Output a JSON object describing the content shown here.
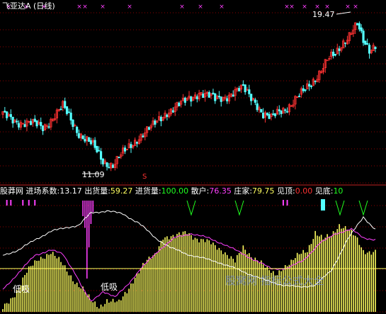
{
  "colors": {
    "background": "#000000",
    "grid": "#8b0000",
    "candle_up": "#ff3232",
    "candle_down": "#54ffff",
    "x_marker": "#ff40ff",
    "white_line": "#ffffff",
    "magenta_line": "#ff40ff",
    "yellow_line": "#ffff60",
    "yellow_bars": "#ffff60",
    "green_v": "#20ff20",
    "cyan_marker": "#54ffff"
  },
  "top_panel": {
    "title": "飞亚达A (日线)",
    "high_label": "19.47",
    "low_label": "11.09",
    "signal_label": "S"
  },
  "bottom_panel": {
    "indicator_name": "股莽网",
    "params": [
      {
        "label": "进场系数:",
        "value": "13.17",
        "color": "#ffffff"
      },
      {
        "label": "出货量:",
        "value": "59.27",
        "color": "#ffff60"
      },
      {
        "label": "进货量:",
        "value": "100.00",
        "color": "#20ff20"
      },
      {
        "label": "散户:",
        "value": "76.35",
        "color": "#ff40ff"
      },
      {
        "label": "庄家:",
        "value": "79.75",
        "color": "#ffff60"
      },
      {
        "label": "见顶:",
        "value": "0.00",
        "color": "#ff3232"
      },
      {
        "label": "见底:",
        "value": "10",
        "color": "#20ff20"
      }
    ],
    "annotations": [
      "低吸",
      "低吸"
    ],
    "watermark": "股窝网 指标公式大全"
  },
  "chart_data": [
    {
      "type": "candlestick",
      "title": "飞亚达A (日线)",
      "annotations": [
        {
          "text": "19.47",
          "type": "high"
        },
        {
          "text": "11.09",
          "type": "low"
        }
      ],
      "close_anchors": [
        [
          0,
          14.1
        ],
        [
          12,
          13.7
        ],
        [
          20,
          13.5
        ],
        [
          30,
          14.6
        ],
        [
          38,
          13.2
        ],
        [
          45,
          12.4
        ],
        [
          50,
          11.6
        ],
        [
          55,
          11.4
        ],
        [
          62,
          12.2
        ],
        [
          68,
          13.0
        ],
        [
          75,
          13.5
        ],
        [
          82,
          14.4
        ],
        [
          90,
          14.8
        ],
        [
          98,
          15.5
        ],
        [
          106,
          15.0
        ],
        [
          114,
          15.4
        ],
        [
          120,
          15.6
        ],
        [
          126,
          15.0
        ],
        [
          130,
          14.2
        ],
        [
          134,
          13.9
        ],
        [
          138,
          14.4
        ],
        [
          144,
          14.8
        ],
        [
          150,
          15.4
        ],
        [
          156,
          16.3
        ],
        [
          162,
          17.2
        ],
        [
          166,
          17.5
        ],
        [
          170,
          18.3
        ],
        [
          174,
          18.9
        ],
        [
          177,
          19.2
        ],
        [
          180,
          18.2
        ],
        [
          183,
          17.8
        ],
        [
          186,
          18.2
        ]
      ],
      "bars": 187,
      "y_range": [
        10.6,
        19.9
      ]
    },
    {
      "type": "bar+line",
      "name": "股莽网",
      "bars_anchors": [
        [
          0,
          3
        ],
        [
          6,
          18
        ],
        [
          12,
          38
        ],
        [
          18,
          52
        ],
        [
          24,
          58
        ],
        [
          30,
          45
        ],
        [
          36,
          30
        ],
        [
          40,
          22
        ],
        [
          44,
          10
        ],
        [
          48,
          5
        ],
        [
          52,
          12
        ],
        [
          58,
          8
        ],
        [
          62,
          20
        ],
        [
          66,
          35
        ],
        [
          70,
          45
        ],
        [
          76,
          55
        ],
        [
          80,
          74
        ],
        [
          86,
          72
        ],
        [
          92,
          78
        ],
        [
          98,
          70
        ],
        [
          104,
          66
        ],
        [
          110,
          60
        ],
        [
          116,
          48
        ],
        [
          120,
          62
        ],
        [
          124,
          55
        ],
        [
          128,
          50
        ],
        [
          132,
          40
        ],
        [
          136,
          36
        ],
        [
          140,
          44
        ],
        [
          144,
          48
        ],
        [
          148,
          55
        ],
        [
          152,
          60
        ],
        [
          156,
          78
        ],
        [
          160,
          70
        ],
        [
          164,
          73
        ],
        [
          168,
          85
        ],
        [
          172,
          82
        ],
        [
          176,
          72
        ],
        [
          180,
          58
        ],
        [
          186,
          60
        ]
      ],
      "white_anchors": [
        [
          0,
          55
        ],
        [
          8,
          60
        ],
        [
          16,
          70
        ],
        [
          24,
          78
        ],
        [
          32,
          82
        ],
        [
          38,
          84
        ],
        [
          44,
          96
        ],
        [
          52,
          98
        ],
        [
          60,
          95
        ],
        [
          68,
          86
        ],
        [
          76,
          72
        ],
        [
          84,
          62
        ],
        [
          92,
          56
        ],
        [
          100,
          52
        ],
        [
          108,
          48
        ],
        [
          116,
          42
        ],
        [
          124,
          36
        ],
        [
          132,
          30
        ],
        [
          140,
          26
        ],
        [
          148,
          24
        ],
        [
          156,
          26
        ],
        [
          164,
          40
        ],
        [
          172,
          70
        ],
        [
          180,
          92
        ],
        [
          186,
          80
        ]
      ],
      "magenta_anchors": [
        [
          0,
          22
        ],
        [
          8,
          38
        ],
        [
          16,
          55
        ],
        [
          24,
          60
        ],
        [
          30,
          56
        ],
        [
          36,
          38
        ],
        [
          40,
          22
        ],
        [
          44,
          10
        ],
        [
          50,
          20
        ],
        [
          56,
          14
        ],
        [
          62,
          26
        ],
        [
          70,
          44
        ],
        [
          78,
          60
        ],
        [
          86,
          72
        ],
        [
          94,
          76
        ],
        [
          102,
          72
        ],
        [
          110,
          66
        ],
        [
          118,
          58
        ],
        [
          126,
          50
        ],
        [
          134,
          42
        ],
        [
          142,
          42
        ],
        [
          150,
          50
        ],
        [
          158,
          66
        ],
        [
          166,
          76
        ],
        [
          174,
          80
        ],
        [
          180,
          72
        ],
        [
          186,
          70
        ]
      ],
      "yellow_line_level": 42,
      "y_range": [
        0,
        110
      ]
    }
  ]
}
